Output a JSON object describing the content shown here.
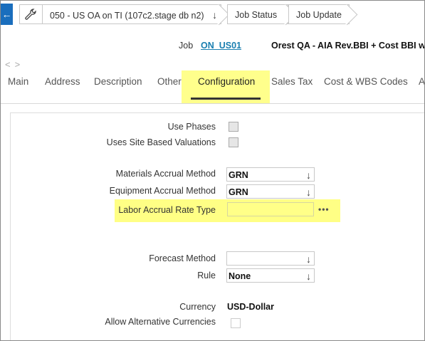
{
  "breadcrumbs": {
    "record": "050 - US OA on TI (107c2.stage db n2)",
    "status": "Job Status",
    "update": "Job Update"
  },
  "job": {
    "label": "Job",
    "code": "ON_US01",
    "description": "Orest QA - AIA Rev.BBI + Cost BBI w/Re"
  },
  "tabs": [
    "Main",
    "Address",
    "Description",
    "Other",
    "Configuration",
    "Sales Tax",
    "Cost & WBS Codes",
    "A"
  ],
  "active_tab": "Configuration",
  "form": {
    "use_phases": "Use Phases",
    "site_valuations": "Uses Site Based Valuations",
    "materials_method": {
      "label": "Materials Accrual Method",
      "value": "GRN"
    },
    "equipment_method": {
      "label": "Equipment Accrual Method",
      "value": "GRN"
    },
    "labor_rate_type": {
      "label": "Labor Accrual Rate Type",
      "value": ""
    },
    "forecast_method": {
      "label": "Forecast Method",
      "value": ""
    },
    "rule": {
      "label": "Rule",
      "value": "None"
    },
    "currency": {
      "label": "Currency",
      "value": "USD-Dollar"
    },
    "alt_currencies": "Allow Alternative Currencies"
  },
  "colors": {
    "accent": "#1a6ebd",
    "highlight": "#ffff66",
    "link": "#1a7fb0"
  }
}
